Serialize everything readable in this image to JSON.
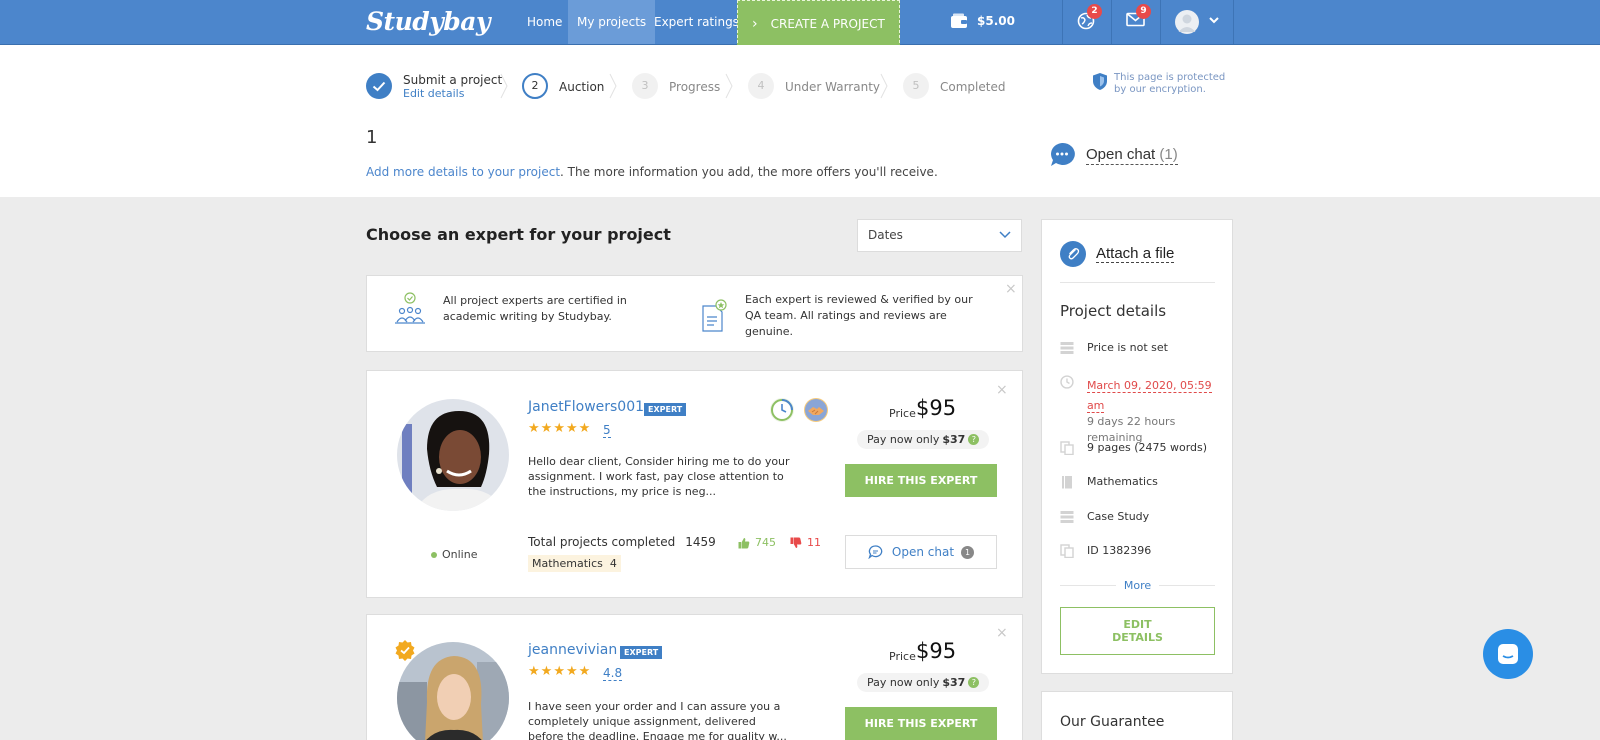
{
  "header": {
    "logo": "Studybay",
    "nav": {
      "home": "Home",
      "my_projects": "My projects",
      "expert_ratings": "Expert ratings"
    },
    "create_project": "CREATE A PROJECT",
    "balance": "$5.00",
    "notifications_count": "2",
    "messages_count": "9",
    "colors": {
      "bar": "#4c86cc",
      "active_tab": "#6b9cd8",
      "create_button": "#8dc063"
    }
  },
  "steps": [
    {
      "label": "Submit a project",
      "sub": "Edit details",
      "state": "done"
    },
    {
      "number": "2",
      "label": "Auction",
      "state": "active"
    },
    {
      "number": "3",
      "label": "Progress",
      "state": "todo"
    },
    {
      "number": "4",
      "label": "Under Warranty",
      "state": "todo"
    },
    {
      "number": "5",
      "label": "Completed",
      "state": "todo"
    }
  ],
  "security": {
    "line1": "This page is protected",
    "line2": "by our encryption."
  },
  "project": {
    "title": "1",
    "add_details_link": "Add more details to your project",
    "add_details_rest": ". The more information you add, the more offers you'll receive."
  },
  "open_chat_top": {
    "label": "Open chat",
    "count": "(1)"
  },
  "main": {
    "section_title": "Choose an expert for your project",
    "sort": {
      "selected": "Dates"
    },
    "info": [
      {
        "icon": "certified-group-icon",
        "text": "All project experts are certified in academic writing by Studybay."
      },
      {
        "icon": "verified-document-icon",
        "text": "Each expert is reviewed & verified by our QA team. All ratings and reviews are genuine."
      }
    ]
  },
  "experts": [
    {
      "name": "JanetFlowers001",
      "badge": "EXPERT",
      "rating": "5",
      "description": "Hello dear client, Consider hiring me to do your assignment. I work fast, pay close attention to the instructions, my price is neg...",
      "price_label": "Price",
      "price": "$95",
      "pay_now_label": "Pay now only",
      "pay_now": "$37",
      "hire_label": "HIRE THIS EXPERT",
      "status": "Online",
      "total_label": "Total projects completed",
      "total": "1459",
      "subject": "Mathematics",
      "subject_count": "4",
      "upvotes": "745",
      "downvotes": "11",
      "chat_label": "Open chat",
      "chat_count": "1"
    },
    {
      "name": "jeannevivian",
      "badge": "EXPERT",
      "rating": "4.8",
      "description": "I have seen your order and I can assure you a completely unique assignment, delivered before the deadline. Engage me for quality w...",
      "price_label": "Price",
      "price": "$95",
      "pay_now_label": "Pay now only",
      "pay_now": "$37",
      "hire_label": "HIRE THIS EXPERT"
    }
  ],
  "sidebar": {
    "attach": "Attach a file",
    "details_title": "Project details",
    "price": "Price is not set",
    "deadline": "March 09, 2020, 05:59 am",
    "remaining": "9 days 22 hours remaining",
    "pages": "9 pages (2475 words)",
    "subject": "Mathematics",
    "type": "Case Study",
    "id": "ID 1382396",
    "more": "More",
    "edit_line1": "EDIT",
    "edit_line2": "DETAILS",
    "guarantee": "Our Guarantee"
  }
}
